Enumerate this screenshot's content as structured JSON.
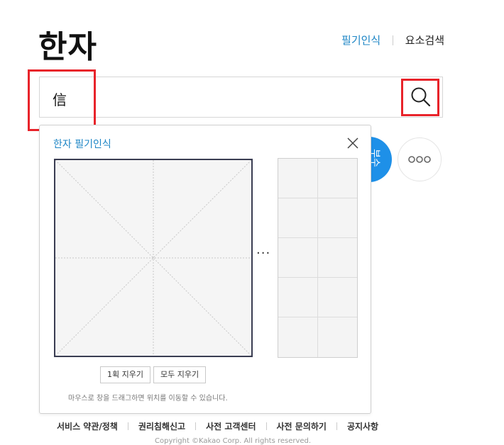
{
  "header": {
    "title": "한자",
    "links": [
      "필기인식",
      "요소검색"
    ]
  },
  "search": {
    "value": "信"
  },
  "side": {
    "blue_button_label": "부수"
  },
  "handwriting_panel": {
    "title": "한자 필기인식",
    "ellipsis": "···",
    "clear_one_label": "1획 지우기",
    "clear_all_label": "모두 지우기",
    "hint": "마우스로 창을 드래그하면 위치를 이동할 수 있습니다."
  },
  "footer": {
    "links": [
      "서비스 약관/정책",
      "권리침해신고",
      "사전 고객센터",
      "사전 문의하기",
      "공지사항"
    ],
    "copyright": "Copyright ©Kakao Corp. All rights reserved."
  },
  "colors": {
    "accent": "#1e86c6",
    "highlight": "#e8232a",
    "blue_button": "#1e90e8"
  }
}
